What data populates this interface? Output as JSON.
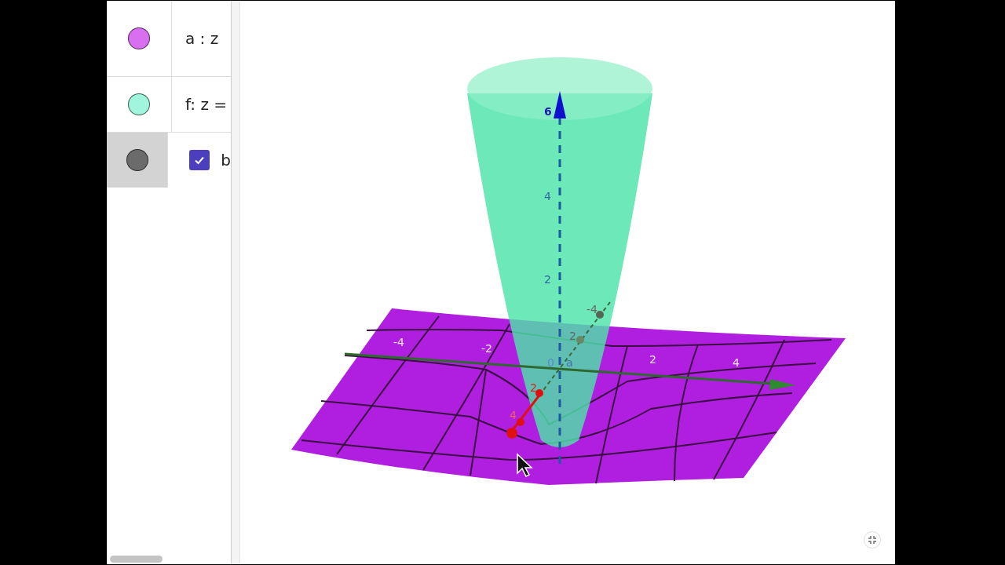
{
  "algebra": {
    "rows": [
      {
        "kind": "object",
        "color": "#d86ef0",
        "label": "a : z",
        "selected": false
      },
      {
        "kind": "object",
        "color": "#a0f5dc",
        "label": "f: z =",
        "selected": false
      },
      {
        "kind": "checkbox",
        "color": "#6b6b6b",
        "label": "b",
        "checked": true,
        "selected": true
      }
    ]
  },
  "view3d": {
    "z_ticks": [
      "6",
      "4",
      "2"
    ],
    "x_ticks": [
      "-4",
      "-2",
      "2",
      "4"
    ],
    "y_ticks": [
      "-4",
      "2",
      "2",
      "4"
    ],
    "origin_labels": [
      "0",
      "a"
    ]
  }
}
